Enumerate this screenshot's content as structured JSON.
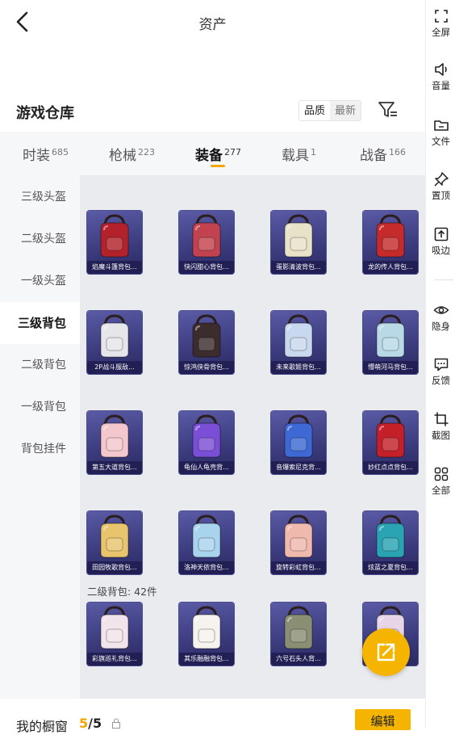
{
  "header": {
    "title": "资产",
    "back_icon": "chevron-left-icon"
  },
  "section": {
    "title": "游戏仓库"
  },
  "sort": {
    "quality": "品质",
    "newest": "最新"
  },
  "tabs": [
    {
      "label": "时装",
      "count": "685"
    },
    {
      "label": "枪械",
      "count": "223"
    },
    {
      "label": "装备",
      "count": "277",
      "active": true
    },
    {
      "label": "载具",
      "count": "1"
    },
    {
      "label": "战备",
      "count": "166"
    }
  ],
  "categories": [
    {
      "label": "三级头盔"
    },
    {
      "label": "二级头盔"
    },
    {
      "label": "一级头盔"
    },
    {
      "label": "三级背包",
      "active": true
    },
    {
      "label": "二级背包"
    },
    {
      "label": "一级背包"
    },
    {
      "label": "背包挂件"
    }
  ],
  "items": [
    {
      "name": "焰魔斗篷背包...",
      "color": "#b3212a"
    },
    {
      "name": "快闪甜心背包...",
      "color": "#c2434f"
    },
    {
      "name": "蛋影清波背包...",
      "color": "#e8e2c8"
    },
    {
      "name": "龙的传人背包...",
      "color": "#c62b2b"
    },
    {
      "name": "2P战斗服敌...",
      "color": "#e6e6ea"
    },
    {
      "name": "惊鸿侠骨背包...",
      "color": "#3c2c2e"
    },
    {
      "name": "未来歌姬背包...",
      "color": "#c8d8ee"
    },
    {
      "name": "懵萌河马背包...",
      "color": "#b9d9e6"
    },
    {
      "name": "第五大道背包...",
      "color": "#f3c7cc"
    },
    {
      "name": "龟仙人龟壳背...",
      "color": "#7a4fd6"
    },
    {
      "name": "音爆索尼克背...",
      "color": "#3e69d4"
    },
    {
      "name": "妙红点点背包...",
      "color": "#c4202a"
    },
    {
      "name": "田园牧歌背包...",
      "color": "#e8c46c"
    },
    {
      "name": "洛神天依背包...",
      "color": "#a9d4ee"
    },
    {
      "name": "旋转彩虹背包...",
      "color": "#f0b9ae"
    },
    {
      "name": "炫蓝之夏背包...",
      "color": "#2aa3b3"
    }
  ],
  "group2": {
    "header": "二级背包: 42件",
    "items": [
      {
        "name": "彩旗巡礼背包...",
        "color": "#f1e4ea"
      },
      {
        "name": "其乐融融背包...",
        "color": "#f6f2ee"
      },
      {
        "name": "六号石头人背...",
        "color": "#8a8f74"
      },
      {
        "name": "",
        "color": "#e6d6e8"
      }
    ]
  },
  "footer": {
    "showcase_label": "我的橱窗",
    "count_current": "5",
    "count_total": "/5",
    "edit_label": "编辑"
  },
  "sidebar": [
    {
      "label": "全屏",
      "icon": "fullscreen-icon"
    },
    {
      "label": "音量",
      "icon": "volume-icon"
    },
    {
      "label": "文件",
      "icon": "folder-icon"
    },
    {
      "label": "置顶",
      "icon": "pin-icon"
    },
    {
      "label": "吸边",
      "icon": "dock-edge-icon"
    },
    {
      "label": "隐身",
      "icon": "eye-icon"
    },
    {
      "label": "反馈",
      "icon": "feedback-icon"
    },
    {
      "label": "截图",
      "icon": "crop-icon"
    },
    {
      "label": "全部",
      "icon": "grid-icon"
    }
  ],
  "accent_color": "#f5b400"
}
